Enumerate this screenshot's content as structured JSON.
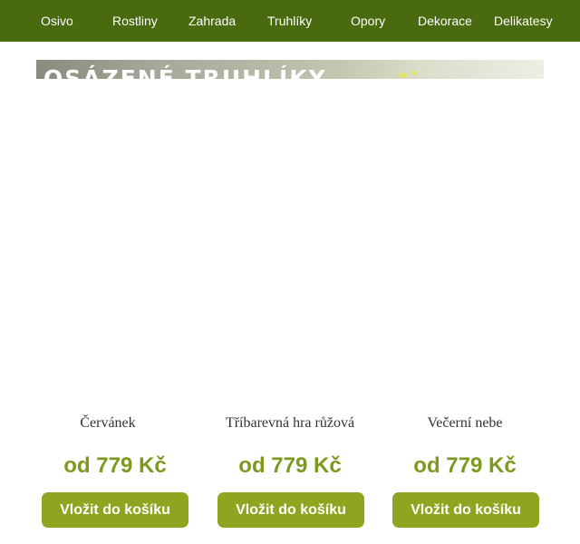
{
  "nav": {
    "items": [
      "Osivo",
      "Rostliny",
      "Zahrada",
      "Truhlíky",
      "Opory",
      "Dekorace",
      "Delikatesy"
    ]
  },
  "banner": {
    "title": "OSÁZENÉ TRUHLÍKY"
  },
  "products": [
    {
      "name": "Červánek",
      "price": "od 779 Kč",
      "button": "Vložit do košíku"
    },
    {
      "name": "Tříbarevná hra růžová",
      "price": "od 779 Kč",
      "button": "Vložit do košíku"
    },
    {
      "name": "Večerní nebe",
      "price": "od 779 Kč",
      "button": "Vložit do košíku"
    }
  ],
  "colors": {
    "nav_background": "#4a6a0f",
    "price": "#7c9a1e",
    "button": "#8fa51f"
  }
}
